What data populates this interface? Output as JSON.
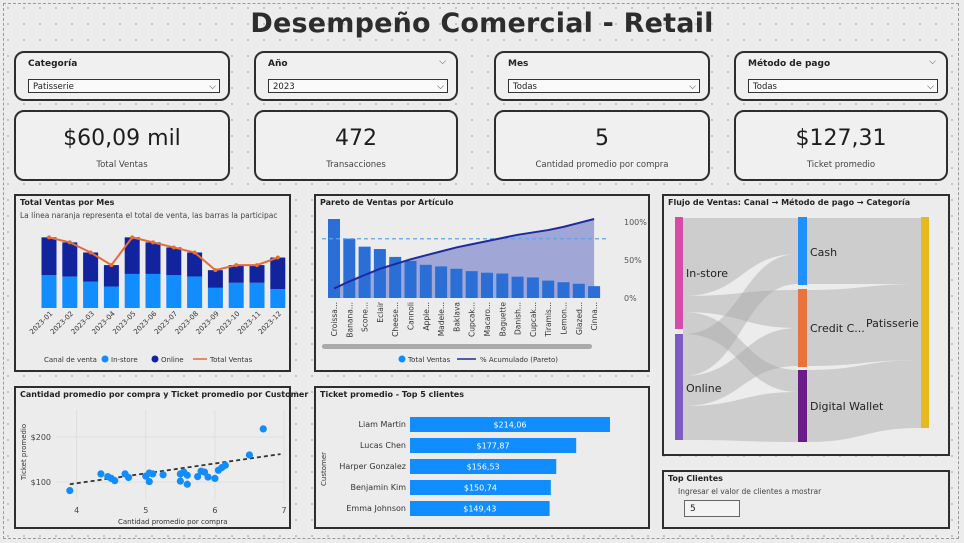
{
  "title": "Desempeño Comercial - Retail",
  "slicers": [
    {
      "label": "Categoría",
      "value": "Patisserie"
    },
    {
      "label": "Año",
      "value": "2023"
    },
    {
      "label": "Mes",
      "value": "Todas"
    },
    {
      "label": "Método de pago",
      "value": "Todas"
    }
  ],
  "kpis": [
    {
      "value": "$60,09 mil",
      "label": "Total Ventas"
    },
    {
      "value": "472",
      "label": "Transacciones"
    },
    {
      "value": "5",
      "label": "Cantidad promedio por compra"
    },
    {
      "value": "$127,31",
      "label": "Ticket promedio"
    }
  ],
  "colors": {
    "instore": "#118dff",
    "online": "#12239e",
    "total_line": "#e66c37",
    "pareto_bar": "#2b6fd6",
    "pareto_line": "#1f2a9c",
    "pareto_area": "#8790d0",
    "cash": "#1e90ff",
    "credit": "#e8743b",
    "digital": "#6b1b8a",
    "patisserie": "#e6b822",
    "instore_node": "#d84aa8",
    "online_node": "#7e5bc4"
  },
  "monthly": {
    "title": "Total Ventas por Mes",
    "subtitle": "La línea naranja representa el total de venta, las barras la participac",
    "legend_title": "Canal de venta",
    "legend": [
      "In-store",
      "Online",
      "Total Ventas"
    ],
    "chart_data": {
      "type": "bar",
      "stacked": true,
      "categories": [
        "2023-01",
        "2023-02",
        "2023-03",
        "2023-04",
        "2023-05",
        "2023-06",
        "2023-07",
        "2023-08",
        "2023-09",
        "2023-10",
        "2023-11",
        "2023-12"
      ],
      "series": [
        {
          "name": "In-store",
          "values": [
            2600,
            2500,
            2100,
            1700,
            2700,
            2700,
            2600,
            2500,
            1600,
            2000,
            2000,
            1500
          ]
        },
        {
          "name": "Online",
          "values": [
            3000,
            2700,
            2300,
            1700,
            2900,
            2500,
            2200,
            1900,
            1400,
            1400,
            1400,
            2500
          ]
        }
      ],
      "line": {
        "name": "Total Ventas",
        "values": [
          5600,
          5200,
          4400,
          3400,
          5600,
          5200,
          4800,
          4400,
          3000,
          3400,
          3400,
          4000
        ]
      }
    }
  },
  "pareto": {
    "title": "Pareto de Ventas por Artículo",
    "legend": [
      "Total Ventas",
      "% Acumulado (Pareto)"
    ],
    "y2_ticks": [
      "100%",
      "50%",
      "0%"
    ],
    "chart_data": {
      "type": "bar",
      "categories": [
        "Croissa...",
        "Banana...",
        "Scone...",
        "Eclair",
        "Cheese...",
        "Cannoli",
        "Apple...",
        "Madele...",
        "Baklava",
        "Cupcak...",
        "Macaro...",
        "Baguette",
        "Danish...",
        "Cupcak...",
        "Tiramis...",
        "Lemon...",
        "Glazed...",
        "Cinna..."
      ],
      "values": [
        100,
        75,
        65,
        62,
        52,
        47,
        42,
        40,
        37,
        34,
        32,
        31,
        27,
        26,
        22,
        20,
        18,
        15
      ],
      "cumulative_pct": [
        0.12,
        0.21,
        0.29,
        0.37,
        0.43,
        0.49,
        0.54,
        0.59,
        0.64,
        0.68,
        0.72,
        0.76,
        0.8,
        0.83,
        0.86,
        0.9,
        0.95,
        1.0
      ],
      "reference_pct": 0.75
    }
  },
  "sankey": {
    "title": "Flujo de Ventas: Canal → Método de pago → Categoría",
    "nodes": {
      "instore": "In-store",
      "online": "Online",
      "cash": "Cash",
      "credit": "Credit C...",
      "digital": "Digital Wallet",
      "patisserie": "Patisserie"
    }
  },
  "scatter": {
    "title": "Cantidad promedio por compra y Ticket promedio por Customer",
    "xlabel": "Cantidad promedio por compra",
    "ylabel": "Ticket promedio",
    "chart_data": {
      "type": "scatter",
      "xlim": [
        3.7,
        7.0
      ],
      "ylim": [
        60,
        260
      ],
      "x_ticks": [
        "4",
        "5",
        "6",
        "7"
      ],
      "y_ticks": [
        "$200",
        "$100"
      ],
      "points": [
        [
          3.9,
          81
        ],
        [
          4.35,
          118
        ],
        [
          4.45,
          112
        ],
        [
          4.5,
          108
        ],
        [
          4.55,
          103
        ],
        [
          4.7,
          118
        ],
        [
          4.75,
          110
        ],
        [
          5.0,
          113
        ],
        [
          5.05,
          120
        ],
        [
          5.05,
          101
        ],
        [
          5.1,
          118
        ],
        [
          5.25,
          116
        ],
        [
          5.5,
          118
        ],
        [
          5.5,
          102
        ],
        [
          5.55,
          122
        ],
        [
          5.6,
          115
        ],
        [
          5.6,
          95
        ],
        [
          5.75,
          112
        ],
        [
          5.8,
          124
        ],
        [
          5.85,
          122
        ],
        [
          5.9,
          111
        ],
        [
          6.0,
          108
        ],
        [
          6.05,
          126
        ],
        [
          6.1,
          132
        ],
        [
          6.15,
          137
        ],
        [
          6.5,
          160
        ],
        [
          6.7,
          218
        ]
      ],
      "trend": [
        [
          3.9,
          95
        ],
        [
          6.95,
          162
        ]
      ]
    }
  },
  "top5": {
    "title": "Ticket promedio - Top 5 clientes",
    "ylabel": "Customer",
    "chart_data": {
      "type": "bar",
      "orientation": "horizontal",
      "categories": [
        "Liam Martin",
        "Lucas Chen",
        "Harper Gonzalez",
        "Benjamin Kim",
        "Emma Johnson"
      ],
      "values": [
        214.06,
        177.87,
        156.53,
        150.74,
        149.43
      ],
      "labels": [
        "$214,06",
        "$177,87",
        "$156,53",
        "$150,74",
        "$149,43"
      ]
    }
  },
  "topclients": {
    "title": "Top Clientes",
    "prompt": "Ingresar el valor de clientes a mostrar",
    "value": "5"
  }
}
